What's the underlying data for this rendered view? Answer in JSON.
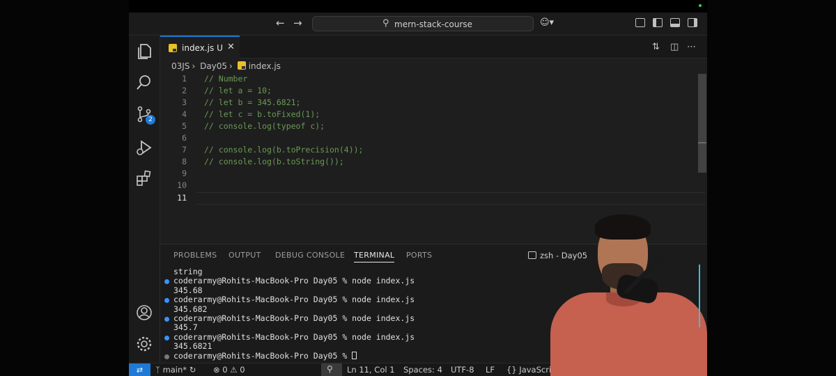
{
  "titlebar": {
    "back_icon": "arrow-left-icon",
    "forward_icon": "arrow-right-icon",
    "search_label": "mern-stack-course",
    "copilot_icon": "copilot-icon"
  },
  "tab": {
    "file_name": "index.js",
    "status": "U"
  },
  "breadcrumb": [
    "03JS",
    "Day05",
    "index.js"
  ],
  "editor": {
    "lines": [
      {
        "num": "1",
        "code": "// Number"
      },
      {
        "num": "2",
        "code": "// let a = 10;"
      },
      {
        "num": "3",
        "code": "// let b = 345.6821;"
      },
      {
        "num": "4",
        "code": "// let c = b.toFixed(1);"
      },
      {
        "num": "5",
        "code": "// console.log(typeof c);"
      },
      {
        "num": "6",
        "code": ""
      },
      {
        "num": "7",
        "code": "// console.log(b.toPrecision(4));"
      },
      {
        "num": "8",
        "code": "// console.log(b.toString());"
      },
      {
        "num": "9",
        "code": ""
      },
      {
        "num": "10",
        "code": ""
      },
      {
        "num": "11",
        "code": ""
      }
    ],
    "active_line": "11"
  },
  "panel": {
    "tabs": [
      "PROBLEMS",
      "OUTPUT",
      "DEBUG CONSOLE",
      "TERMINAL",
      "PORTS"
    ],
    "active_tab": "TERMINAL",
    "terminal_name": "zsh - Day05",
    "terminal_lines": [
      {
        "prompt": false,
        "text": "string"
      },
      {
        "prompt": true,
        "text": "coderarmy@Rohits-MacBook-Pro Day05 % node index.js"
      },
      {
        "prompt": false,
        "text": "345.68"
      },
      {
        "prompt": true,
        "text": "coderarmy@Rohits-MacBook-Pro Day05 % node index.js"
      },
      {
        "prompt": false,
        "text": "345.682"
      },
      {
        "prompt": true,
        "text": "coderarmy@Rohits-MacBook-Pro Day05 % node index.js"
      },
      {
        "prompt": false,
        "text": "345.7"
      },
      {
        "prompt": true,
        "text": "coderarmy@Rohits-MacBook-Pro Day05 % node index.js"
      },
      {
        "prompt": false,
        "text": "345.6821"
      }
    ],
    "last_prompt": "coderarmy@Rohits-MacBook-Pro Day05 % "
  },
  "statusbar": {
    "branch": "main*",
    "errors": "0",
    "warnings": "0",
    "cursor_position": "Ln 11, Col 1",
    "spaces": "Spaces: 4",
    "encoding": "UTF-8",
    "eol": "LF",
    "language": "JavaScript"
  },
  "colors": {
    "accent": "#1f7ad6",
    "comment": "#6a9955",
    "js_badge": "#e8c028"
  }
}
